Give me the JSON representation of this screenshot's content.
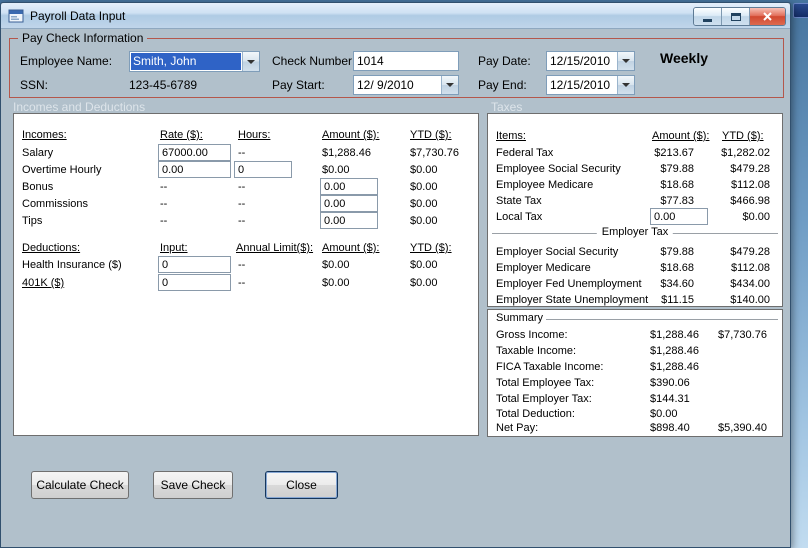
{
  "window": {
    "title": "Payroll Data Input"
  },
  "paycheck": {
    "group_label": "Pay Check Information",
    "employee_name_label": "Employee Name:",
    "employee_name": "Smith, John",
    "ssn_label": "SSN:",
    "ssn": "123-45-6789",
    "check_number_label": "Check Number:",
    "check_number": "1014",
    "pay_start_label": "Pay Start:",
    "pay_start": "12/ 9/2010",
    "pay_date_label": "Pay Date:",
    "pay_date": "12/15/2010",
    "pay_end_label": "Pay End:",
    "pay_end": "12/15/2010",
    "frequency": "Weekly"
  },
  "sections": {
    "incomes_deductions": "Incomes and Deductions",
    "taxes": "Taxes"
  },
  "incomes": {
    "headers": {
      "name": "Incomes:",
      "rate": "Rate ($):",
      "hours": "Hours:",
      "amount": "Amount ($):",
      "ytd": "YTD ($):"
    },
    "rows": [
      {
        "name": "Salary",
        "rate": "67000.00",
        "hours": "--",
        "amount": "$1,288.46",
        "ytd": "$7,730.76"
      },
      {
        "name": "Overtime Hourly",
        "rate": "0.00",
        "hours": "0",
        "amount": "$0.00",
        "ytd": "$0.00"
      },
      {
        "name": "Bonus",
        "rate": "--",
        "hours": "--",
        "amount": "0.00",
        "ytd": "$0.00"
      },
      {
        "name": "Commissions",
        "rate": "--",
        "hours": "--",
        "amount": "0.00",
        "ytd": "$0.00"
      },
      {
        "name": "Tips",
        "rate": "--",
        "hours": "--",
        "amount": "0.00",
        "ytd": "$0.00"
      }
    ]
  },
  "deductions": {
    "headers": {
      "name": "Deductions:",
      "input": "Input:",
      "limit": "Annual Limit($):",
      "amount": "Amount ($):",
      "ytd": "YTD ($):"
    },
    "rows": [
      {
        "name": "Health Insurance  ($)",
        "input": "0",
        "limit": "--",
        "amount": "$0.00",
        "ytd": "$0.00"
      },
      {
        "name": "401K  ($)",
        "input": "0",
        "limit": "--",
        "amount": "$0.00",
        "ytd": "$0.00"
      }
    ]
  },
  "taxes": {
    "headers": {
      "items": "Items:",
      "amount": "Amount ($):",
      "ytd": "YTD ($):"
    },
    "rows": [
      {
        "name": "Federal Tax",
        "amount": "$213.67",
        "ytd": "$1,282.02"
      },
      {
        "name": "Employee Social Security",
        "amount": "$79.88",
        "ytd": "$479.28"
      },
      {
        "name": "Employee Medicare",
        "amount": "$18.68",
        "ytd": "$112.08"
      },
      {
        "name": "State Tax",
        "amount": "$77.83",
        "ytd": "$466.98"
      }
    ],
    "local_tax": {
      "name": "Local Tax",
      "amount": "0.00",
      "ytd": "$0.00"
    },
    "employer_label": "Employer Tax",
    "employer_rows": [
      {
        "name": "Employer Social Security",
        "amount": "$79.88",
        "ytd": "$479.28"
      },
      {
        "name": "Employer Medicare",
        "amount": "$18.68",
        "ytd": "$112.08"
      },
      {
        "name": "Employer Fed Unemployment",
        "amount": "$34.60",
        "ytd": "$434.00"
      },
      {
        "name": "Employer State Unemployment",
        "amount": "$11.15",
        "ytd": "$140.00"
      }
    ]
  },
  "summary": {
    "group_label": "Summary",
    "rows": [
      {
        "name": "Gross Income:",
        "value": "$1,288.46",
        "ytd": "$7,730.76"
      },
      {
        "name": "Taxable Income:",
        "value": "$1,288.46",
        "ytd": ""
      },
      {
        "name": "FICA Taxable Income:",
        "value": "$1,288.46",
        "ytd": ""
      },
      {
        "name": "Total Employee Tax:",
        "value": "$390.06",
        "ytd": ""
      },
      {
        "name": "Total Employer Tax:",
        "value": "$144.31",
        "ytd": ""
      },
      {
        "name": "Total Deduction:",
        "value": "$0.00",
        "ytd": ""
      },
      {
        "name": "Net Pay:",
        "value": "$898.40",
        "ytd": "$5,390.40"
      }
    ]
  },
  "buttons": {
    "calculate": "Calculate Check",
    "save": "Save Check",
    "close": "Close"
  }
}
